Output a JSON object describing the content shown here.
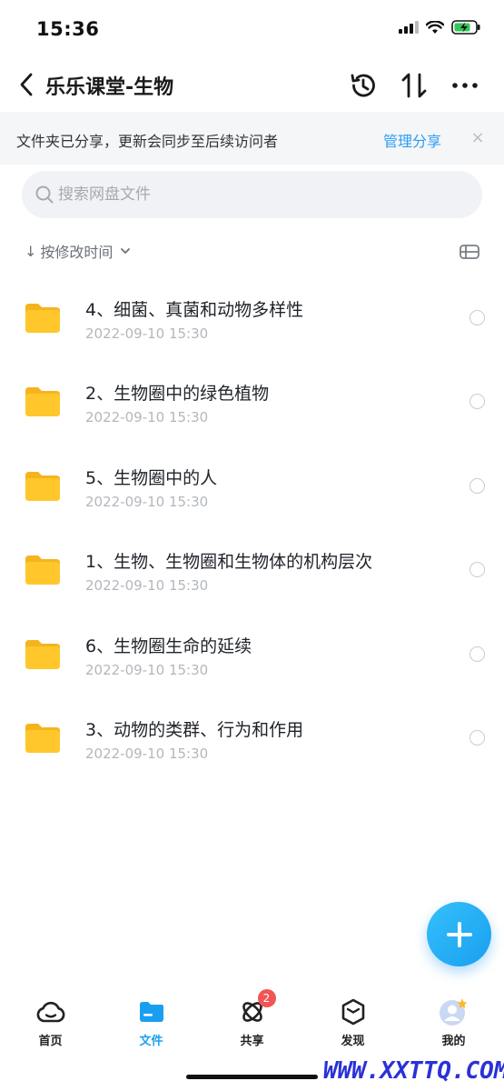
{
  "status": {
    "time": "15:36"
  },
  "nav": {
    "title": "乐乐课堂-生物"
  },
  "banner": {
    "text": "文件夹已分享，更新会同步至后续访问者",
    "link": "管理分享",
    "close": "×"
  },
  "search": {
    "placeholder": "搜索网盘文件"
  },
  "sort": {
    "arrow": "↓",
    "label": "按修改时间"
  },
  "files": [
    {
      "name": "4、细菌、真菌和动物多样性",
      "date": "2022-09-10 15:30"
    },
    {
      "name": "2、生物圈中的绿色植物",
      "date": "2022-09-10 15:30"
    },
    {
      "name": "5、生物圈中的人",
      "date": "2022-09-10 15:30"
    },
    {
      "name": "1、生物、生物圈和生物体的机构层次",
      "date": "2022-09-10 15:30"
    },
    {
      "name": "6、生物圈生命的延续",
      "date": "2022-09-10 15:30"
    },
    {
      "name": "3、动物的类群、行为和作用",
      "date": "2022-09-10 15:30"
    }
  ],
  "tabs": [
    {
      "label": "首页",
      "icon": "cloud-icon"
    },
    {
      "label": "文件",
      "icon": "folder-icon",
      "active": true
    },
    {
      "label": "共享",
      "icon": "orbit-icon",
      "badge": "2"
    },
    {
      "label": "发现",
      "icon": "cube-icon"
    },
    {
      "label": "我的",
      "icon": "avatar-icon"
    }
  ],
  "watermark": "WWW.XXTTQ.COM",
  "colors": {
    "accent": "#1a9ff0",
    "folder": "#ffc72c",
    "badge": "#f25555",
    "banner_bg": "#f5f6f8"
  }
}
